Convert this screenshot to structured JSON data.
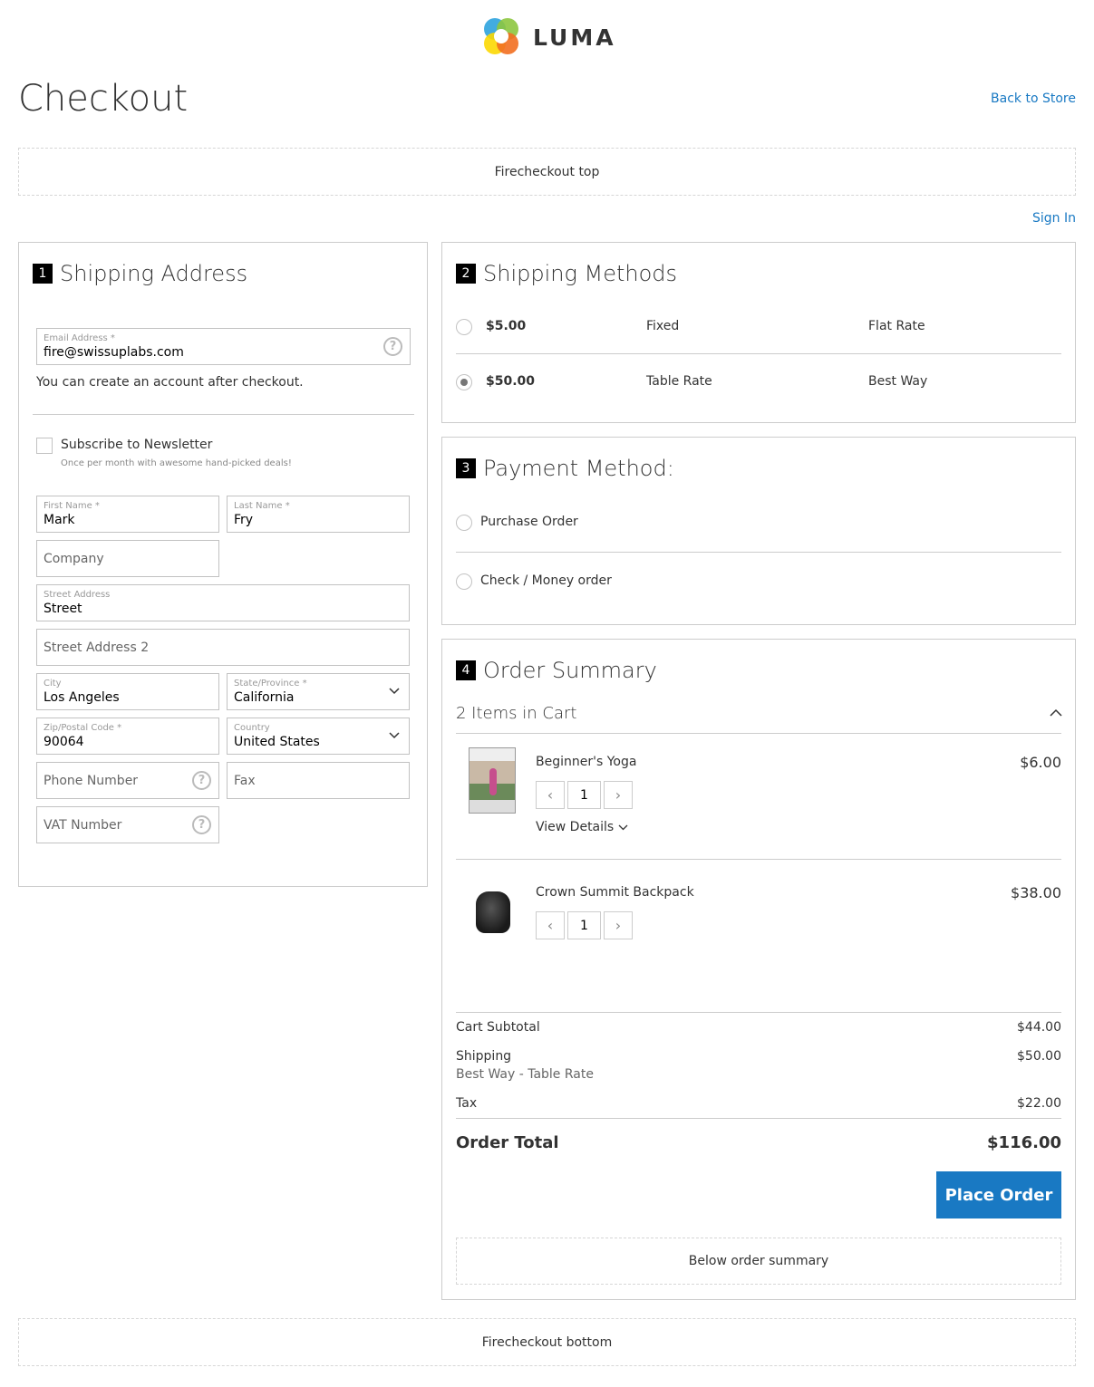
{
  "brand": {
    "name": "LUMA"
  },
  "header": {
    "title": "Checkout",
    "back_link": "Back to Store"
  },
  "top_area": "Firecheckout top",
  "sign_in": "Sign In",
  "shipping_address": {
    "step": "1",
    "title": "Shipping Address",
    "email": {
      "label": "Email Address *",
      "value": "fire@swissuplabs.com"
    },
    "account_note": "You can create an account after checkout.",
    "newsletter": {
      "label": "Subscribe to Newsletter",
      "note": "Once per month with awesome hand-picked deals!"
    },
    "first_name": {
      "label": "First Name *",
      "value": "Mark"
    },
    "last_name": {
      "label": "Last Name *",
      "value": "Fry"
    },
    "company": {
      "placeholder": "Company"
    },
    "street": {
      "label": "Street Address",
      "value": "Street"
    },
    "street2": {
      "placeholder": "Street Address 2"
    },
    "city": {
      "label": "City",
      "value": "Los Angeles"
    },
    "state": {
      "label": "State/Province *",
      "value": "California"
    },
    "zip": {
      "label": "Zip/Postal Code *",
      "value": "90064"
    },
    "country": {
      "label": "Country",
      "value": "United States"
    },
    "phone": {
      "placeholder": "Phone Number"
    },
    "fax": {
      "placeholder": "Fax"
    },
    "vat": {
      "placeholder": "VAT Number"
    }
  },
  "shipping_methods": {
    "step": "2",
    "title": "Shipping Methods",
    "options": [
      {
        "price": "$5.00",
        "method": "Fixed",
        "carrier": "Flat Rate",
        "selected": false
      },
      {
        "price": "$50.00",
        "method": "Table Rate",
        "carrier": "Best Way",
        "selected": true
      }
    ]
  },
  "payment": {
    "step": "3",
    "title": "Payment Method:",
    "options": [
      {
        "label": "Purchase Order"
      },
      {
        "label": "Check / Money order"
      }
    ]
  },
  "summary": {
    "step": "4",
    "title": "Order Summary",
    "items_count": "2 Items in Cart",
    "items": [
      {
        "name": "Beginner's Yoga",
        "qty": "1",
        "price": "$6.00",
        "details": "View Details"
      },
      {
        "name": "Crown Summit Backpack",
        "qty": "1",
        "price": "$38.00"
      }
    ],
    "subtotal_label": "Cart Subtotal",
    "subtotal": "$44.00",
    "shipping_label": "Shipping",
    "shipping_desc": "Best Way - Table Rate",
    "shipping": "$50.00",
    "tax_label": "Tax",
    "tax": "$22.00",
    "total_label": "Order Total",
    "total": "$116.00",
    "place_order": "Place Order",
    "below": "Below order summary"
  },
  "bottom_area": "Firecheckout bottom",
  "colors": {
    "accent": "#1979c3"
  }
}
